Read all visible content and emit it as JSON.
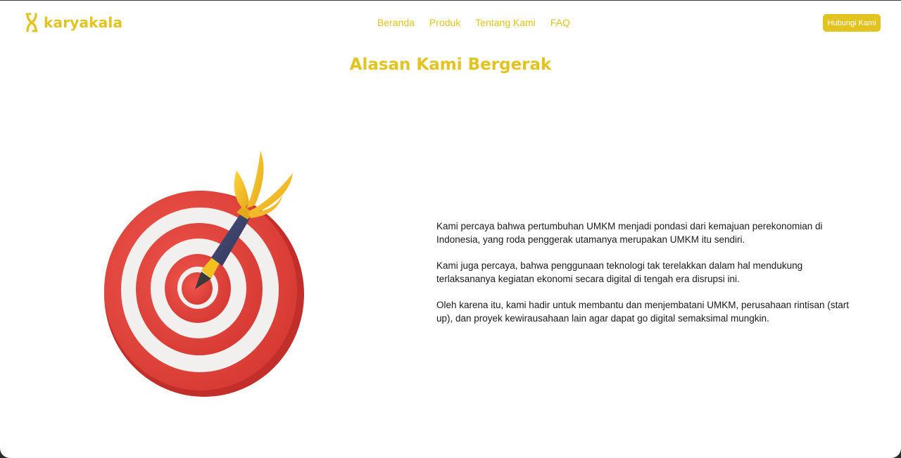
{
  "brand": {
    "name": "karyakala",
    "color": "#e3c31f"
  },
  "nav": {
    "items": [
      {
        "label": "Beranda"
      },
      {
        "label": "Produk"
      },
      {
        "label": "Tentang Kami"
      },
      {
        "label": "FAQ"
      }
    ],
    "cta_label": "Hubungi Kami"
  },
  "section": {
    "title": "Alasan Kami Bergerak",
    "illustration": "dartboard-target-icon",
    "paragraphs": [
      "Kami percaya bahwa pertumbuhan UMKM menjadi pondasi dari kemajuan perekonomian di Indonesia, yang roda penggerak utamanya merupakan UMKM itu sendiri.",
      "Kami juga percaya, bahwa penggunaan teknologi tak terelakkan dalam hal mendukung terlaksananya kegiatan ekonomi secara digital di tengah era disrupsi ini.",
      "Oleh karena itu, kami hadir untuk membantu dan menjembatani UMKM, perusahaan rintisan (start up), dan proyek kewirausahaan lain agar dapat go digital semaksimal mungkin."
    ]
  },
  "colors": {
    "accent": "#e3c31f",
    "target_red": "#e8473f",
    "target_white": "#f1eeee",
    "dart_body": "#3d4266"
  }
}
